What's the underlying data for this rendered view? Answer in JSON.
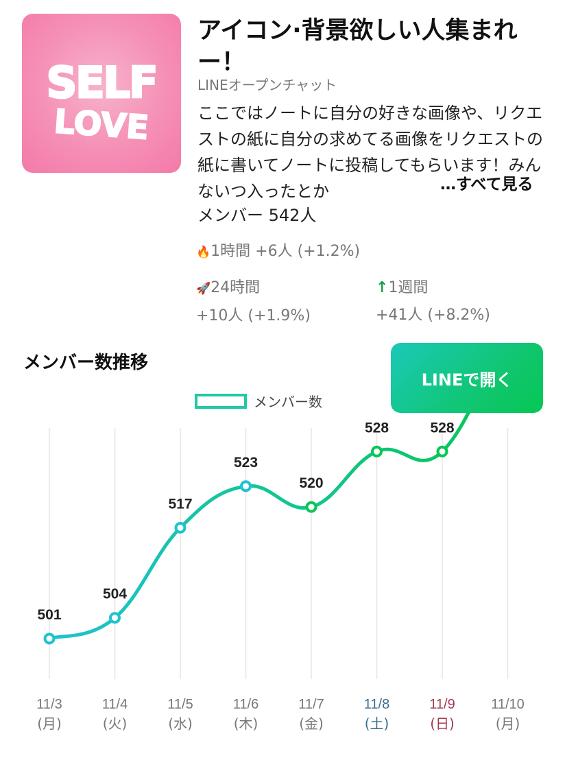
{
  "header": {
    "title": "アイコン·背景欲しい人集まれー！",
    "source": "LINEオープンチャット",
    "description": "ここではノートに自分の好きな画像や、リクエストの紙に自分の求めてる画像をリクエストの紙に書いてノートに投稿してもらいます！みんないつ入ったとか",
    "see_all": "…すべて見る",
    "members": "メンバー 542人",
    "thumbnail_text_1": "SELF",
    "thumbnail_text_2": "LOVE"
  },
  "stats": {
    "hour": {
      "icon": "🔥",
      "label": "1時間",
      "value": "+6人 (+1.2%)"
    },
    "day": {
      "icon": "🚀",
      "label": "24時間",
      "value": "+10人 (+1.9%)"
    },
    "week": {
      "icon": "↑",
      "label": "1週間",
      "value": "+41人 (+8.2%)"
    }
  },
  "section_title": "メンバー数推移",
  "open_button": "LINEで開く",
  "colors": {
    "line_start": "#1ec3d0",
    "line_end": "#06c755",
    "saturday": "#3a6d8c",
    "sunday": "#a33a4e",
    "weekday": "#777777"
  },
  "chart_data": {
    "type": "line",
    "legend": [
      "メンバー数"
    ],
    "categories": [
      "11/3",
      "11/4",
      "11/5",
      "11/6",
      "11/7",
      "11/8",
      "11/9",
      "11/10"
    ],
    "weekdays": [
      "(月)",
      "(火)",
      "(水)",
      "(木)",
      "(金)",
      "(土)",
      "(日)",
      "(月)"
    ],
    "series": [
      {
        "name": "メンバー数",
        "values": [
          501,
          504,
          517,
          523,
          520,
          528,
          528,
          546
        ]
      }
    ],
    "grid": "vertical"
  }
}
